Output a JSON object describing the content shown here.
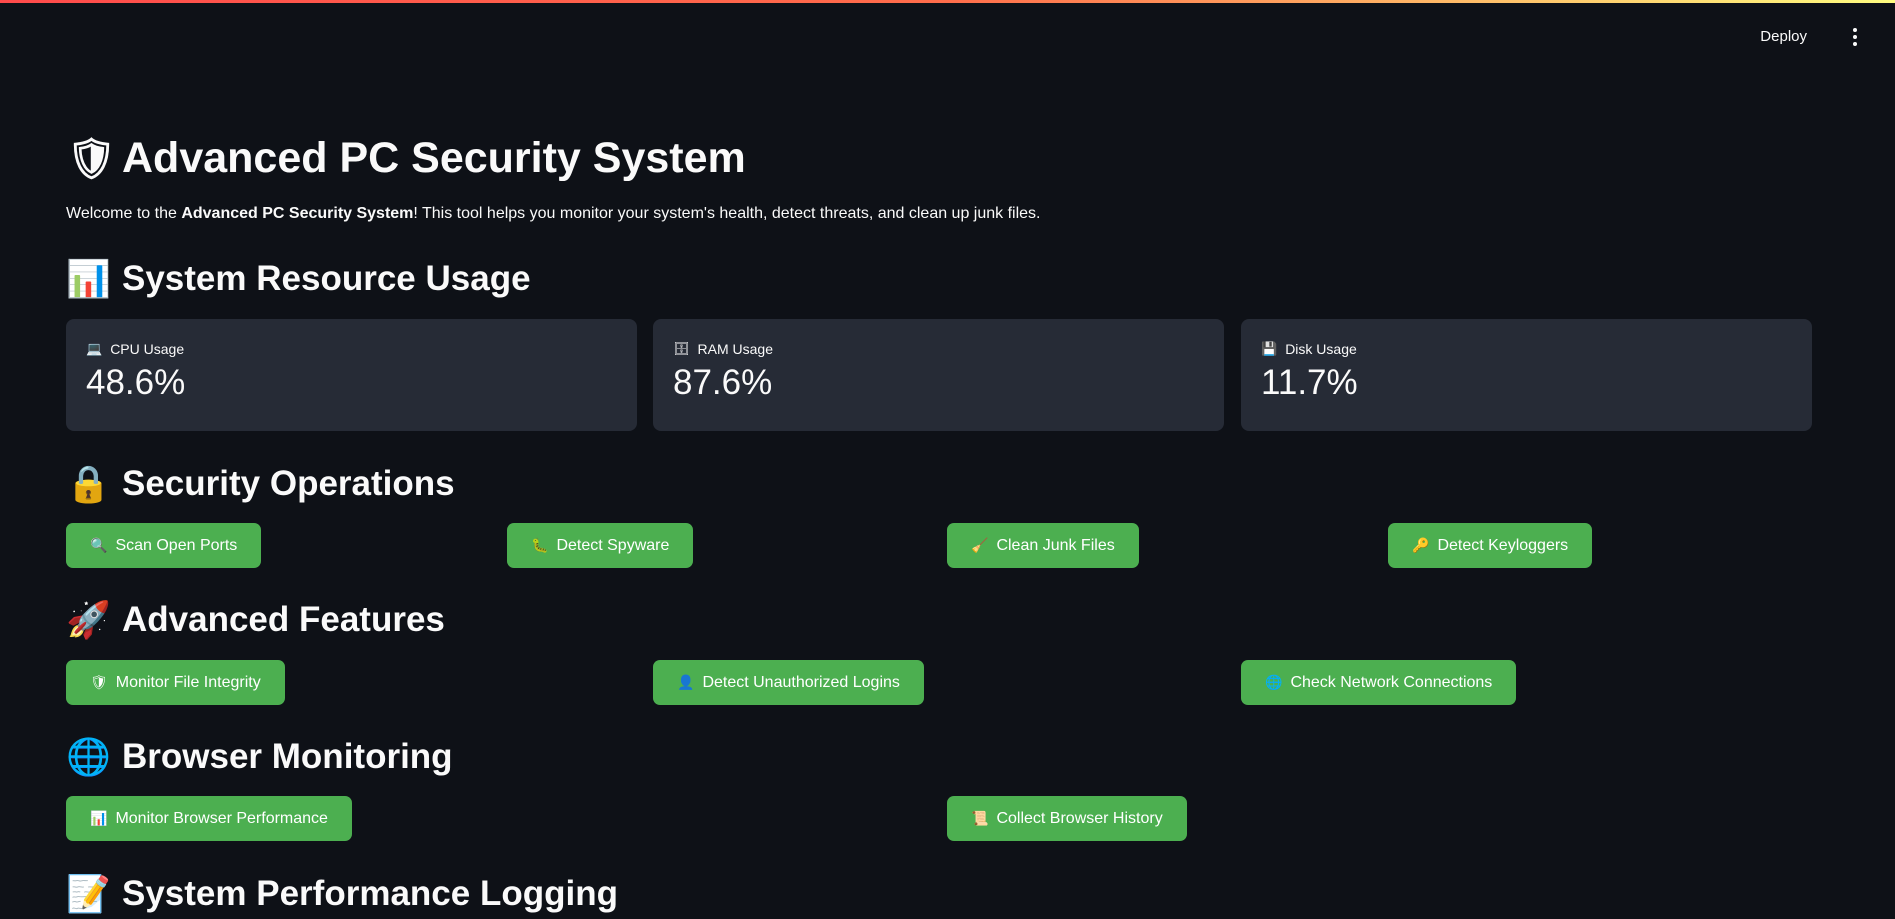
{
  "topbar": {
    "deploy_label": "Deploy"
  },
  "header": {
    "title": "Advanced PC Security System",
    "intro_prefix": "Welcome to the ",
    "intro_bold": "Advanced PC Security System",
    "intro_suffix": "! This tool helps you monitor your system's health, detect threats, and clean up junk files."
  },
  "sections": {
    "resources": "System Resource Usage",
    "security": "Security Operations",
    "advanced": "Advanced Features",
    "browser": "Browser Monitoring",
    "logging": "System Performance Logging"
  },
  "metrics": [
    {
      "label": "CPU Usage",
      "value": "48.6%",
      "icon": "laptop-icon"
    },
    {
      "label": "RAM Usage",
      "value": "87.6%",
      "icon": "memory-icon"
    },
    {
      "label": "Disk Usage",
      "value": "11.7%",
      "icon": "floppy-disk-icon"
    }
  ],
  "security_buttons": [
    {
      "label": "Scan Open Ports",
      "icon": "magnifier-icon"
    },
    {
      "label": "Detect Spyware",
      "icon": "bug-icon"
    },
    {
      "label": "Clean Junk Files",
      "icon": "broom-icon"
    },
    {
      "label": "Detect Keyloggers",
      "icon": "key-icon"
    }
  ],
  "advanced_buttons": [
    {
      "label": "Monitor File Integrity",
      "icon": "shield-icon"
    },
    {
      "label": "Detect Unauthorized Logins",
      "icon": "user-icon"
    },
    {
      "label": "Check Network Connections",
      "icon": "globe-icon"
    }
  ],
  "browser_buttons": [
    {
      "label": "Monitor Browser Performance",
      "icon": "bar-chart-icon"
    },
    {
      "label": "Collect Browser History",
      "icon": "scroll-icon"
    }
  ],
  "colors": {
    "background": "#0e1117",
    "card": "#262b36",
    "button": "#4caf50",
    "text": "#fafafa"
  }
}
